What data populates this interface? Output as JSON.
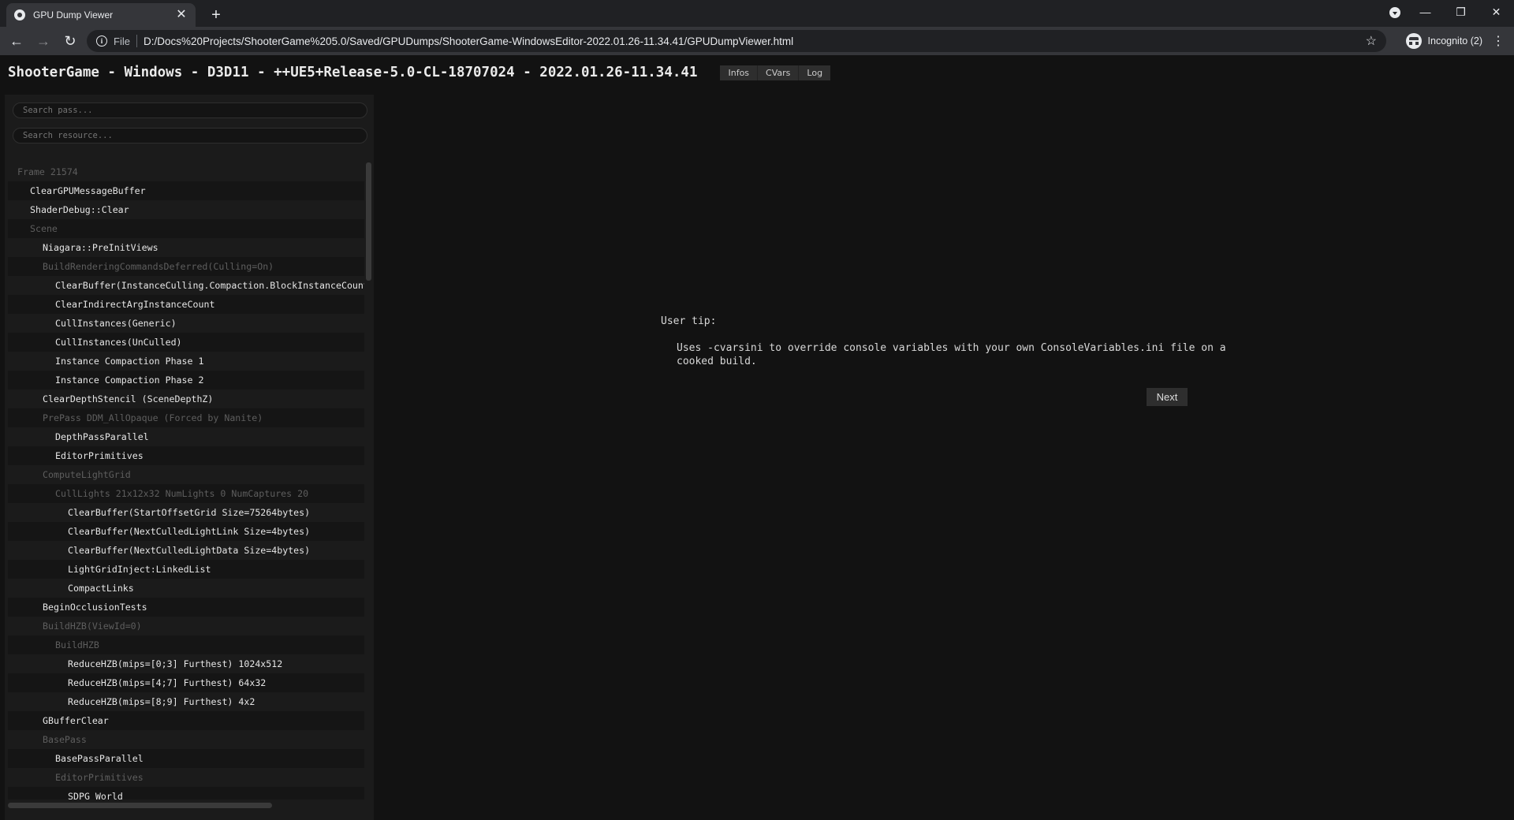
{
  "browser": {
    "tab_title": "GPU Dump Viewer",
    "url_scheme": "File",
    "url": "D:/Docs%20Projects/ShooterGame%205.0/Saved/GPUDumps/ShooterGame-WindowsEditor-2022.01.26-11.34.41/GPUDumpViewer.html",
    "profile_label": "Incognito (2)"
  },
  "header": {
    "title": "ShooterGame - Windows - D3D11 - ++UE5+Release-5.0-CL-18707024 - 2022.01.26-11.34.41",
    "buttons": [
      "Infos",
      "CVars",
      "Log"
    ]
  },
  "search": {
    "pass_placeholder": "Search pass...",
    "resource_placeholder": "Search resource..."
  },
  "passes": [
    {
      "label": "Frame 21574",
      "indent": 0,
      "group": true
    },
    {
      "label": "ClearGPUMessageBuffer",
      "indent": 1,
      "group": false
    },
    {
      "label": "ShaderDebug::Clear",
      "indent": 1,
      "group": false
    },
    {
      "label": "Scene",
      "indent": 1,
      "group": true
    },
    {
      "label": "Niagara::PreInitViews",
      "indent": 2,
      "group": false
    },
    {
      "label": "BuildRenderingCommandsDeferred(Culling=On)",
      "indent": 2,
      "group": true
    },
    {
      "label": "ClearBuffer(InstanceCulling.Compaction.BlockInstanceCounts Size=4bytes)",
      "indent": 3,
      "group": false
    },
    {
      "label": "ClearIndirectArgInstanceCount",
      "indent": 3,
      "group": false
    },
    {
      "label": "CullInstances(Generic)",
      "indent": 3,
      "group": false
    },
    {
      "label": "CullInstances(UnCulled)",
      "indent": 3,
      "group": false
    },
    {
      "label": "Instance Compaction Phase 1",
      "indent": 3,
      "group": false
    },
    {
      "label": "Instance Compaction Phase 2",
      "indent": 3,
      "group": false
    },
    {
      "label": "ClearDepthStencil (SceneDepthZ)",
      "indent": 2,
      "group": false
    },
    {
      "label": "PrePass DDM_AllOpaque (Forced by Nanite)",
      "indent": 2,
      "group": true
    },
    {
      "label": "DepthPassParallel",
      "indent": 3,
      "group": false
    },
    {
      "label": "EditorPrimitives",
      "indent": 3,
      "group": false
    },
    {
      "label": "ComputeLightGrid",
      "indent": 2,
      "group": true
    },
    {
      "label": "CullLights 21x12x32 NumLights 0 NumCaptures 20",
      "indent": 3,
      "group": true
    },
    {
      "label": "ClearBuffer(StartOffsetGrid Size=75264bytes)",
      "indent": 4,
      "group": false
    },
    {
      "label": "ClearBuffer(NextCulledLightLink Size=4bytes)",
      "indent": 4,
      "group": false
    },
    {
      "label": "ClearBuffer(NextCulledLightData Size=4bytes)",
      "indent": 4,
      "group": false
    },
    {
      "label": "LightGridInject:LinkedList",
      "indent": 4,
      "group": false
    },
    {
      "label": "CompactLinks",
      "indent": 4,
      "group": false
    },
    {
      "label": "BeginOcclusionTests",
      "indent": 2,
      "group": false
    },
    {
      "label": "BuildHZB(ViewId=0)",
      "indent": 2,
      "group": true
    },
    {
      "label": "BuildHZB",
      "indent": 3,
      "group": true
    },
    {
      "label": "ReduceHZB(mips=[0;3] Furthest) 1024x512",
      "indent": 4,
      "group": false
    },
    {
      "label": "ReduceHZB(mips=[4;7] Furthest) 64x32",
      "indent": 4,
      "group": false
    },
    {
      "label": "ReduceHZB(mips=[8;9] Furthest) 4x2",
      "indent": 4,
      "group": false
    },
    {
      "label": "GBufferClear",
      "indent": 2,
      "group": false
    },
    {
      "label": "BasePass",
      "indent": 2,
      "group": true
    },
    {
      "label": "BasePassParallel",
      "indent": 3,
      "group": false
    },
    {
      "label": "EditorPrimitives",
      "indent": 3,
      "group": true
    },
    {
      "label": "SDPG_World",
      "indent": 4,
      "group": false
    }
  ],
  "tip": {
    "header": "User tip:",
    "text": "Uses -cvarsini to override console variables with your own ConsoleVariables.ini file on a cooked build.",
    "next_label": "Next"
  },
  "icons": {
    "tab_favicon": "globe-icon",
    "tab_close": "close-icon",
    "new_tab": "plus-icon",
    "back": "back-arrow-icon",
    "forward": "forward-arrow-icon",
    "reload": "reload-icon",
    "site_info": "info-icon",
    "bookmark": "star-icon",
    "incognito": "incognito-icon",
    "menu": "kebab-menu-icon"
  }
}
